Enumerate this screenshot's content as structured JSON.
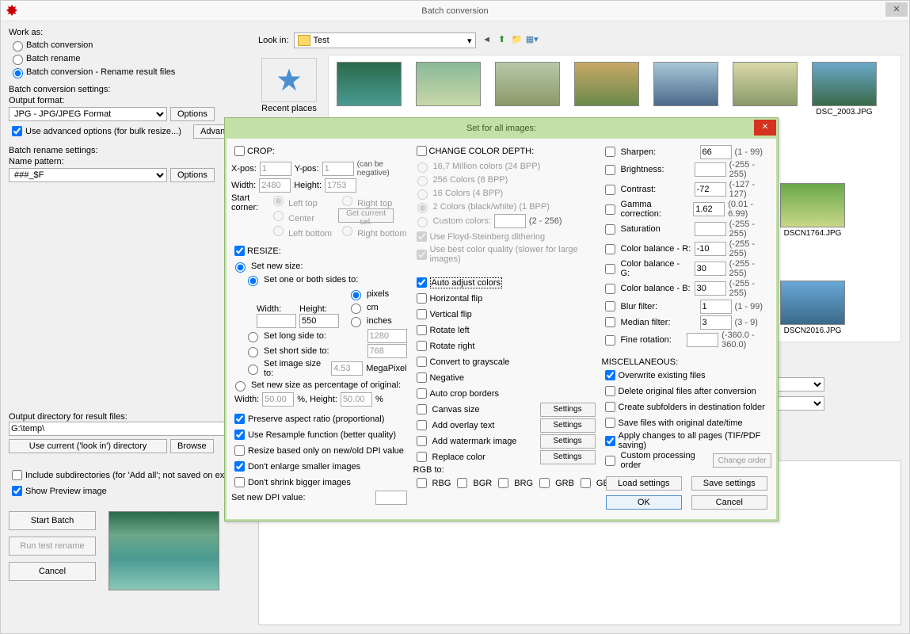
{
  "main": {
    "title": "Batch conversion",
    "workAs": {
      "label": "Work as:",
      "opts": [
        "Batch conversion",
        "Batch rename",
        "Batch conversion - Rename result files"
      ],
      "selected": 2
    },
    "convSettings": {
      "label": "Batch conversion settings:",
      "outputFormatLabel": "Output format:",
      "outputFormat": "JPG - JPG/JPEG Format",
      "optionsBtn": "Options",
      "advCheck": "Use advanced options (for bulk resize...)",
      "advancedBtn": "Advanced"
    },
    "renameSettings": {
      "label": "Batch rename settings:",
      "namePatternLabel": "Name pattern:",
      "namePattern": "###_$F",
      "optionsBtn": "Options"
    },
    "lookInLabel": "Look in:",
    "lookInFolder": "Test",
    "recentPlacesLabel": "Recent places",
    "thumbs": [
      "",
      "",
      "",
      "",
      "",
      "",
      "DSC_2003.JPG",
      "",
      "",
      "DSCN1764.JPG",
      "",
      "",
      "DSCN2016.JPG"
    ],
    "outputDirLabel": "Output directory for result files:",
    "outputDir": "G:\\temp\\",
    "useCurrentBtn": "Use current ('look in') directory",
    "browseBtn": "Browse",
    "includeSubdirs": "Include subdirectories (for 'Add all'; not saved on exit)",
    "showPreview": "Show Preview image",
    "startBatchBtn": "Start Batch",
    "runTestBtn": "Run test rename",
    "cancelBtn": "Cancel"
  },
  "modal": {
    "title": "Set for all images:",
    "crop": {
      "label": "CROP:",
      "xpos": "X-pos:",
      "xposVal": "1",
      "ypos": "Y-pos:",
      "yposVal": "1",
      "width": "Width:",
      "widthVal": "2480",
      "height": "Height:",
      "heightVal": "1753",
      "canBeNeg": "(can be negative)",
      "startCorner": "Start corner:",
      "corners": [
        "Left top",
        "Right top",
        "Center",
        "Left bottom",
        "Right bottom"
      ],
      "getCurrentSel": "Get current sel."
    },
    "resize": {
      "label": "RESIZE:",
      "setNewSize": "Set new size:",
      "setOneOrBoth": "Set one or both sides to:",
      "widthLbl": "Width:",
      "widthVal": "",
      "heightLbl": "Height:",
      "heightVal": "550",
      "units": [
        "pixels",
        "cm",
        "inches"
      ],
      "setLongSide": "Set long side to:",
      "longVal": "1280",
      "setShortSide": "Set short side to:",
      "shortVal": "768",
      "setImageSize": "Set image size to:",
      "imgSizeVal": "4.53",
      "mp": "MegaPixel",
      "setPercent": "Set new size as percentage of original:",
      "percWidth": "Width:",
      "percWidthVal": "50.00",
      "percHeight": "%, Height:",
      "percHeightVal": "50.00",
      "percSuffix": "%",
      "preserveAspect": "Preserve aspect ratio (proportional)",
      "useResample": "Use Resample function (better quality)",
      "resizeBased": "Resize based only on new/old DPI value",
      "dontEnlarge": "Don't enlarge smaller images",
      "dontShrink": "Don't shrink bigger images",
      "setDpi": "Set new DPI value:",
      "dpiVal": ""
    },
    "colorDepth": {
      "label": "CHANGE COLOR DEPTH:",
      "opts": [
        "16,7 Million colors (24 BPP)",
        "256 Colors (8 BPP)",
        "16 Colors (4 BPP)",
        "2 Colors (black/white) (1 BPP)",
        "Custom colors:"
      ],
      "customRange": "(2 - 256)",
      "floyd": "Use Floyd-Steinberg dithering",
      "bestQuality": "Use best color quality (slower for large images)"
    },
    "adjust": {
      "autoAdjust": "Auto adjust colors",
      "hflip": "Horizontal flip",
      "vflip": "Vertical flip",
      "rotLeft": "Rotate left",
      "rotRight": "Rotate right",
      "grayscale": "Convert to grayscale",
      "negative": "Negative",
      "autoCrop": "Auto crop borders",
      "canvasSize": "Canvas size",
      "overlayText": "Add overlay text",
      "watermark": "Add watermark image",
      "replaceColor": "Replace color",
      "settingsBtn": "Settings",
      "rgbTo": "RGB to:",
      "rgbOpts": [
        "RBG",
        "BGR",
        "BRG",
        "GRB",
        "GBR"
      ]
    },
    "filters": {
      "sharpen": {
        "label": "Sharpen:",
        "val": "66",
        "range": "(1  -  99)"
      },
      "brightness": {
        "label": "Brightness:",
        "val": "",
        "range": "(-255  -  255)"
      },
      "contrast": {
        "label": "Contrast:",
        "val": "-72",
        "range": "(-127  -  127)"
      },
      "gamma": {
        "label": "Gamma correction:",
        "val": "1.62",
        "range": "(0.01  -  6.99)"
      },
      "saturation": {
        "label": "Saturation",
        "val": "",
        "range": "(-255  -  255)"
      },
      "balR": {
        "label": "Color balance - R:",
        "val": "-10",
        "range": "(-255  -  255)"
      },
      "balG": {
        "label": "Color balance - G:",
        "val": "30",
        "range": "(-255  -  255)"
      },
      "balB": {
        "label": "Color balance - B:",
        "val": "30",
        "range": "(-255  -  255)"
      },
      "blur": {
        "label": "Blur filter:",
        "val": "1",
        "range": "(1  -  99)"
      },
      "median": {
        "label": "Median filter:",
        "val": "3",
        "range": "(3  -  9)"
      },
      "fineRot": {
        "label": "Fine rotation:",
        "val": "",
        "range": "(-360.0  -  360.0)"
      }
    },
    "misc": {
      "label": "MISCELLANEOUS:",
      "overwrite": "Overwrite existing files",
      "deleteOrig": "Delete original files after conversion",
      "createSub": "Create subfolders in destination folder",
      "saveDate": "Save files with original date/time",
      "applyAll": "Apply changes to all pages (TIF/PDF saving)",
      "customOrder": "Custom processing order",
      "changeOrder": "Change order",
      "loadBtn": "Load settings",
      "saveBtn": "Save settings",
      "okBtn": "OK",
      "cancelBtn": "Cancel"
    }
  }
}
